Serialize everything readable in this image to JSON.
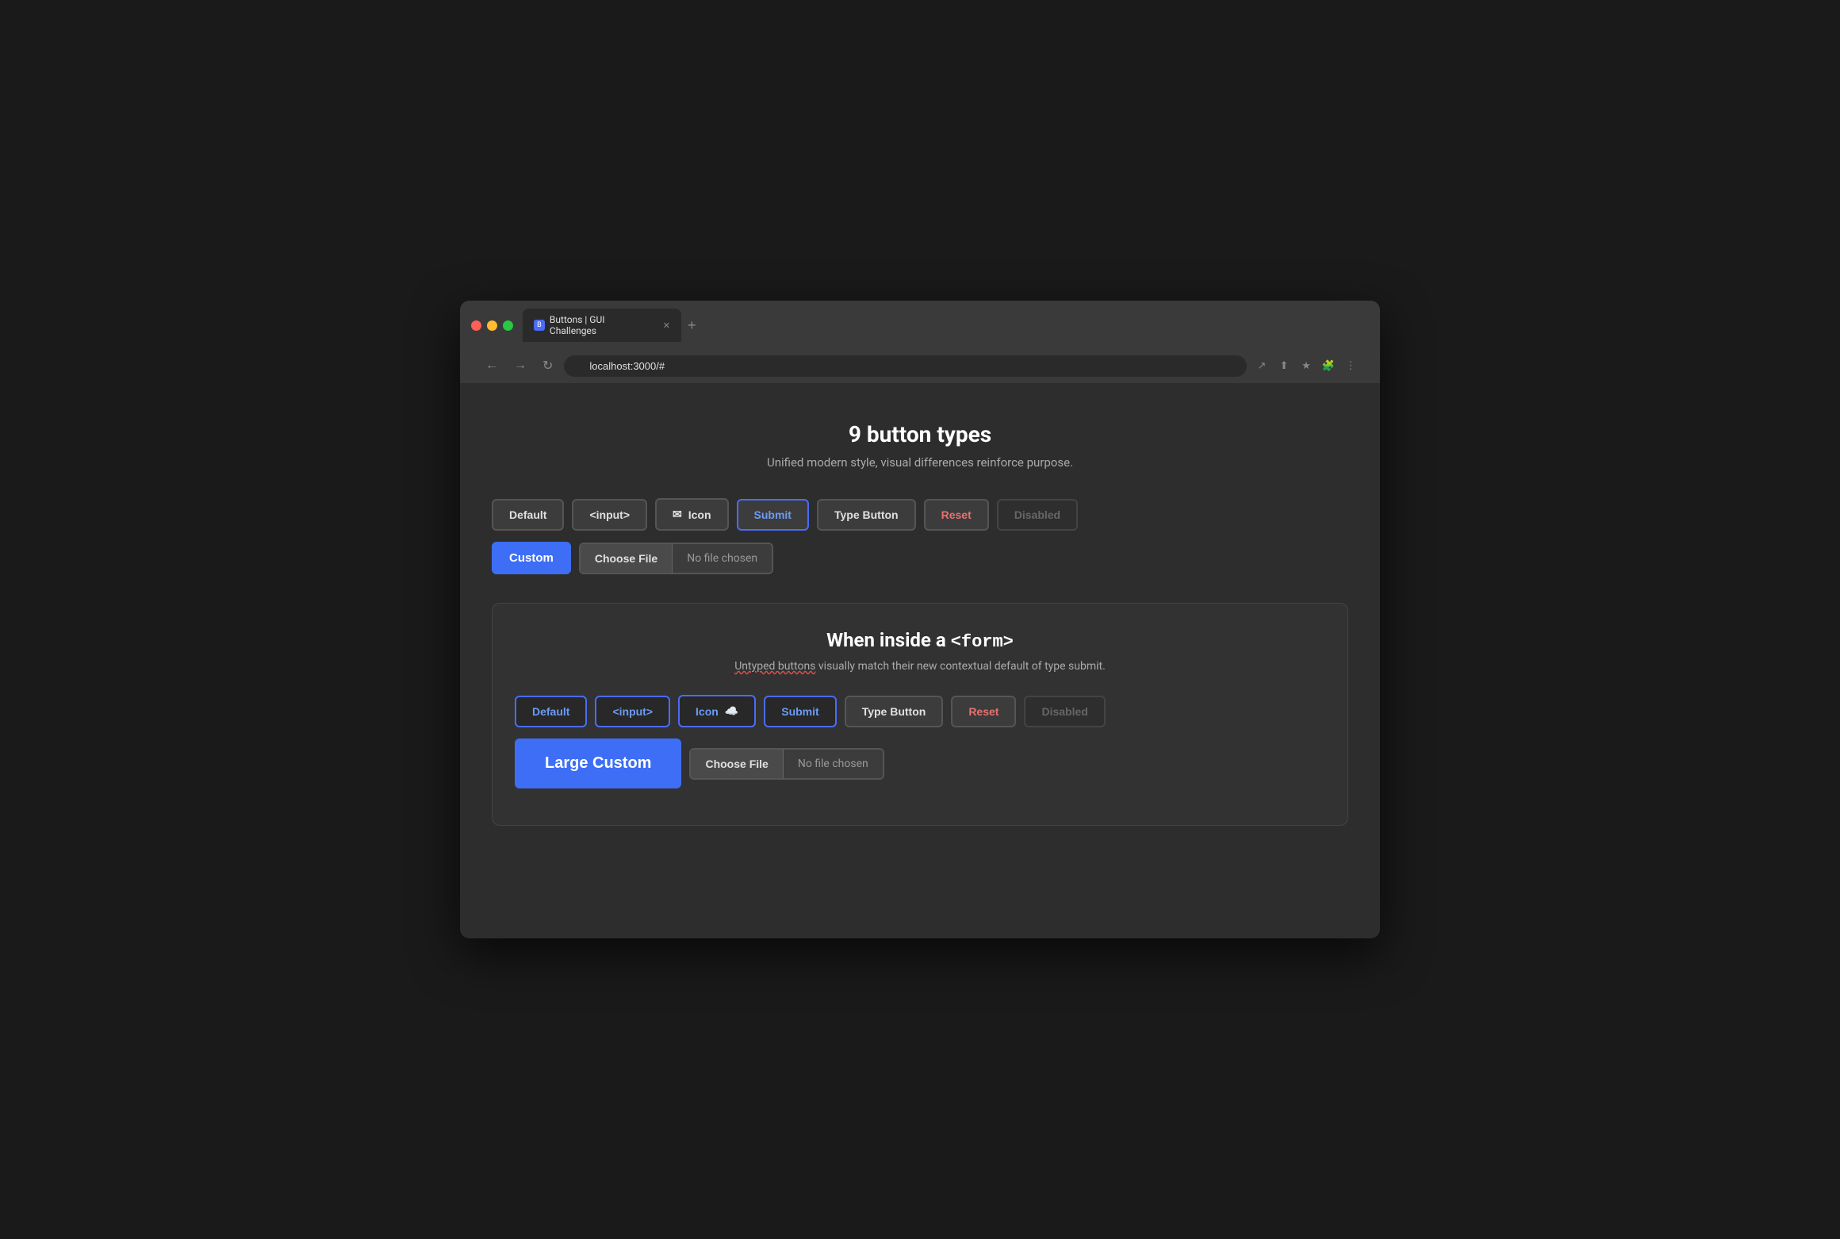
{
  "browser": {
    "tab_title": "Buttons | GUI Challenges",
    "tab_favicon": "B",
    "address": "localhost:3000/#",
    "new_tab_label": "+",
    "nav": {
      "back": "←",
      "forward": "→",
      "reload": "↻"
    }
  },
  "page": {
    "title": "9 button types",
    "subtitle": "Unified modern style, visual differences reinforce purpose.",
    "section1": {
      "buttons": {
        "default": "Default",
        "input": "<input>",
        "icon": "Icon",
        "submit": "Submit",
        "type_button": "Type Button",
        "reset": "Reset",
        "disabled": "Disabled",
        "custom": "Custom",
        "file_choose": "Choose File",
        "file_no_chosen": "No file chosen"
      }
    },
    "section2": {
      "title": "When inside a ",
      "title_code": "<form>",
      "subtitle_before": "Untyped buttons",
      "subtitle_after": " visually match their new contextual default of type submit.",
      "buttons": {
        "default": "Default",
        "input": "<input>",
        "icon": "Icon",
        "submit": "Submit",
        "type_button": "Type Button",
        "reset": "Reset",
        "disabled": "Disabled",
        "large_custom": "Large Custom",
        "file_choose": "Choose File",
        "file_no_chosen": "No file chosen"
      }
    }
  }
}
